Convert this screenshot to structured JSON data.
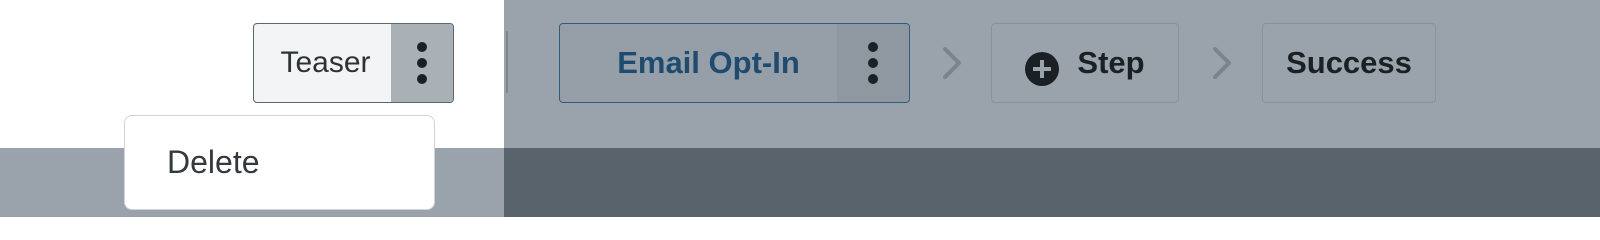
{
  "steps": {
    "teaser": {
      "label": "Teaser"
    },
    "email": {
      "label": "Email Opt-In"
    },
    "add_step": {
      "label": "Step"
    },
    "success": {
      "label": "Success"
    }
  },
  "menu": {
    "items": [
      {
        "label": "Delete"
      }
    ]
  },
  "icons": {
    "kebab": "more-vertical-icon",
    "plus": "add-circle-icon",
    "chevron": "chevron-right-icon"
  },
  "colors": {
    "overlay": "#9aa3ac",
    "overlay_dark": "#58636c",
    "email_accent": "#1e4c70"
  }
}
